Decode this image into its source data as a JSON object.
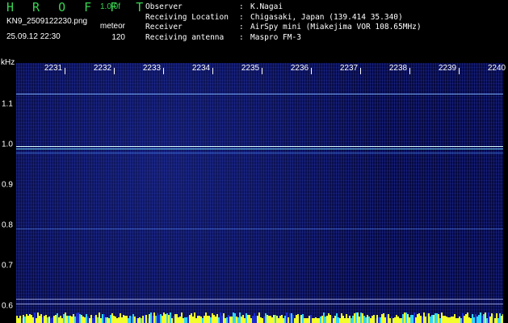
{
  "header": {
    "app_title": "H R O F F T",
    "version": "1.0.0f",
    "filename": "KN9_2509122230.png",
    "datetime": "25.09.12 22:30",
    "mode": "meteor",
    "count": "120"
  },
  "meta": [
    {
      "key": "Observer",
      "value": "K.Nagai"
    },
    {
      "key": "Receiving Location",
      "value": "Chigasaki, Japan (139.414 35.340)"
    },
    {
      "key": "Receiver",
      "value": "AirSpy mini (Miakejima VOR 108.65MHz)"
    },
    {
      "key": "Receiving antenna",
      "value": "Maspro FM-3"
    }
  ],
  "plot": {
    "y_unit": "kHz",
    "time_labels": [
      "2231",
      "2232",
      "2233",
      "2234",
      "2235",
      "2236",
      "2237",
      "2238",
      "2239",
      "2240"
    ],
    "freq_labels": [
      "1.1",
      "1.0",
      "0.9",
      "0.8",
      "0.7",
      "0.6"
    ],
    "colors": {
      "background": "#0a0f5a",
      "trace_bright": "#9ff5ff",
      "trace_mid": "#5a8cff",
      "strip": "#f2ff2a"
    }
  }
}
